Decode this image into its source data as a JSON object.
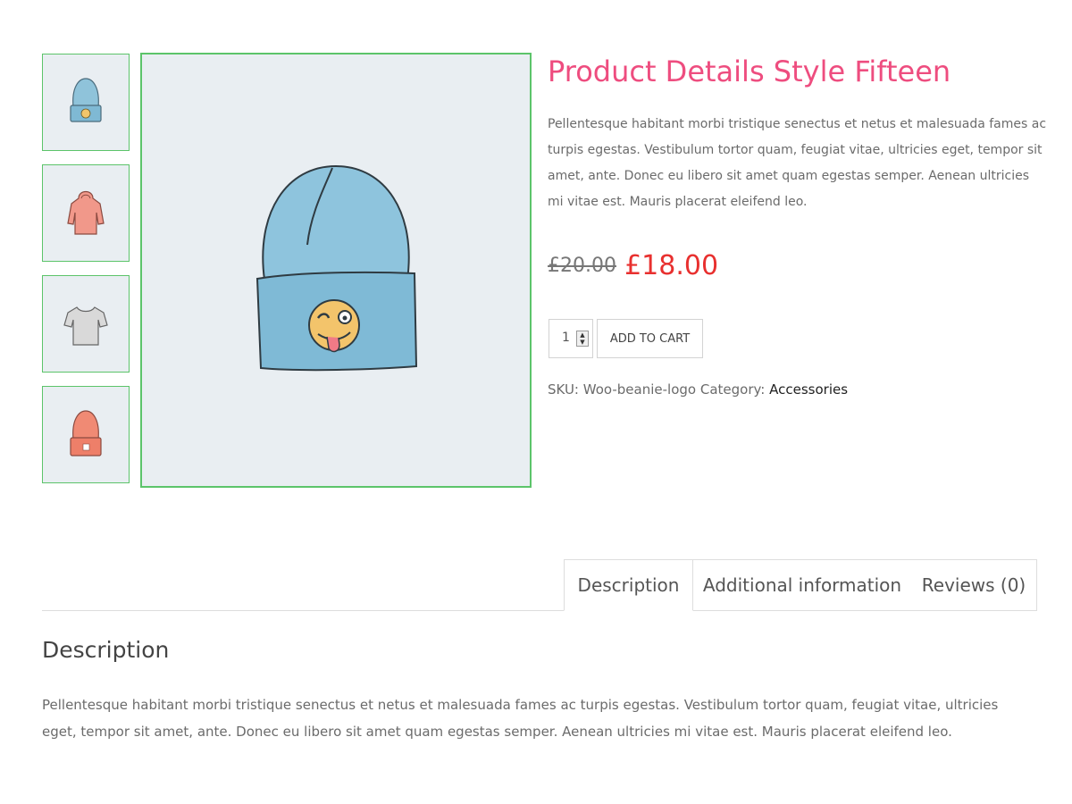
{
  "product": {
    "title": "Product Details Style Fifteen",
    "short_description": "Pellentesque habitant morbi tristique senectus et netus et malesuada fames ac turpis egestas. Vestibulum tortor quam, feugiat vitae, ultricies eget, tempor sit amet, ante. Donec eu libero sit amet quam egestas semper. Aenean ultricies mi vitae est. Mauris placerat eleifend leo.",
    "price_old": "£20.00",
    "price_new": "£18.00",
    "quantity": "1",
    "add_to_cart_label": "ADD TO CART",
    "sku_label": "SKU:",
    "sku_value": "Woo-beanie-logo",
    "category_label": "Category:",
    "category_value": "Accessories"
  },
  "gallery": {
    "thumbnails": [
      "blue-beanie-icon",
      "pink-hoodie-icon",
      "grey-tshirt-icon",
      "orange-beanie-icon"
    ],
    "main_image": "blue-beanie-icon"
  },
  "tabs": [
    {
      "label": "Description",
      "active": true
    },
    {
      "label": "Additional information",
      "active": false
    },
    {
      "label": "Reviews (0)",
      "active": false
    }
  ],
  "description_section": {
    "heading": "Description",
    "body": "Pellentesque habitant morbi tristique senectus et netus et malesuada fames ac turpis egestas. Vestibulum tortor quam, feugiat vitae, ultricies eget, tempor sit amet, ante. Donec eu libero sit amet quam egestas semper. Aenean ultricies mi vitae est. Mauris placerat eleifend leo."
  },
  "colors": {
    "title": "#ee4d7f",
    "price_new": "#e8302f",
    "active_border": "#5cc46a",
    "image_background": "#e9eef2"
  }
}
